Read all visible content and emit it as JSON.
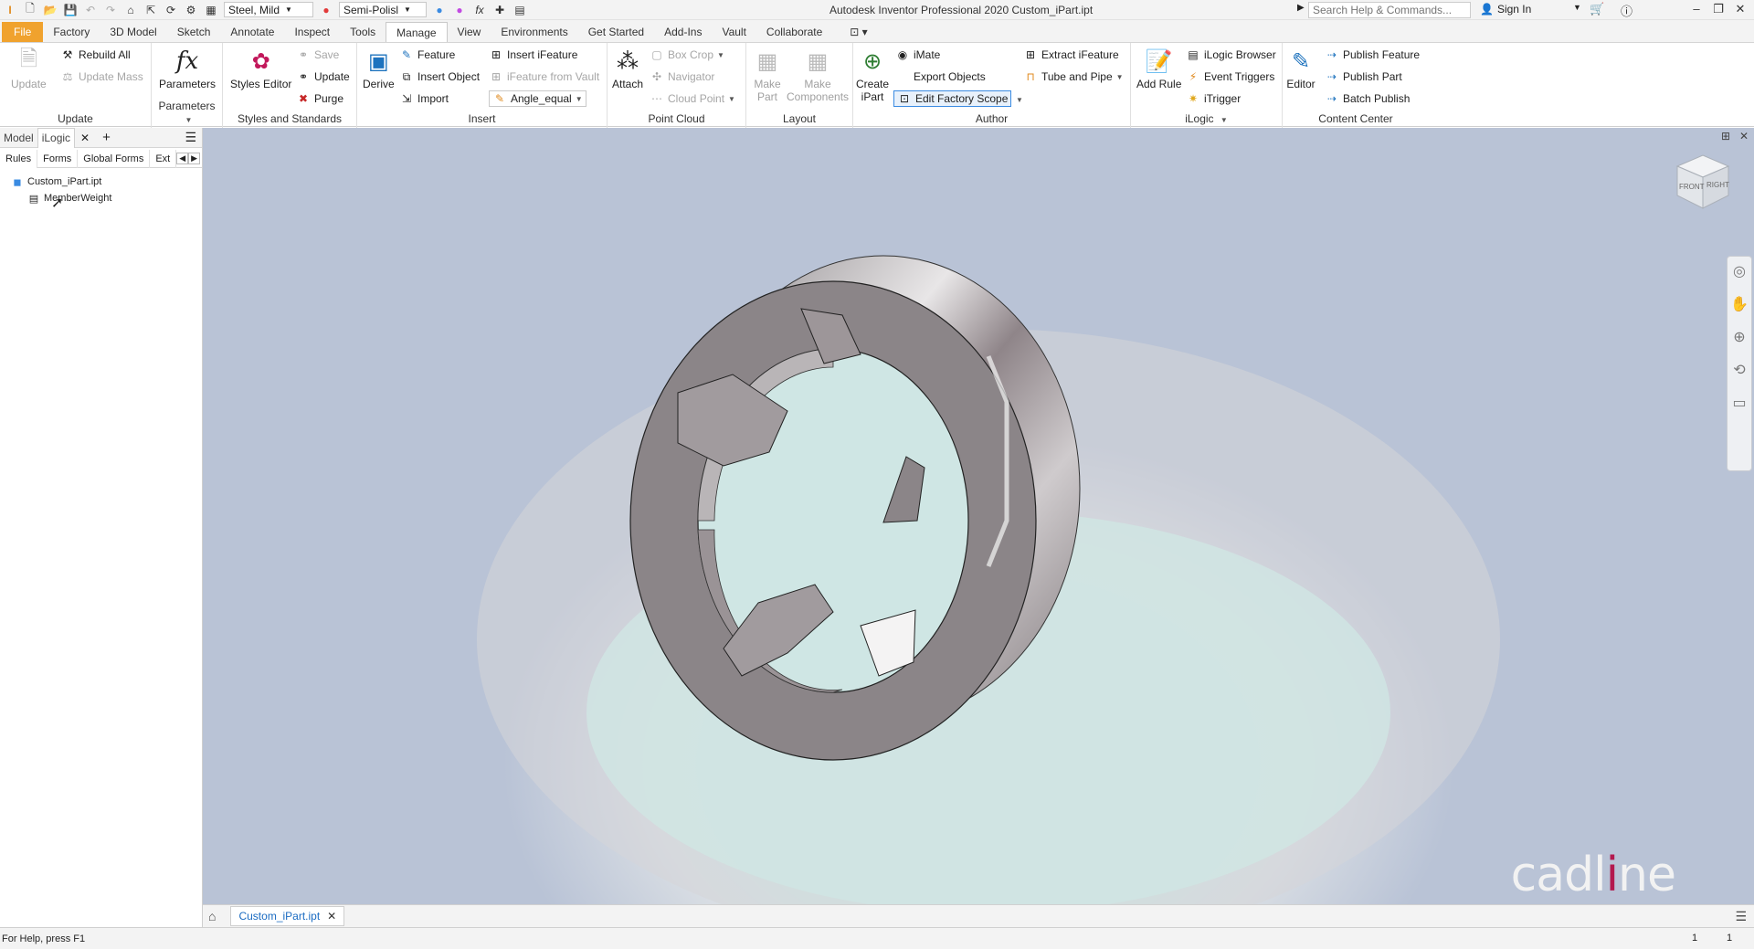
{
  "titlebar": {
    "material": "Steel, Mild",
    "appearance": "Semi-Polisl",
    "app_title": "Autodesk Inventor Professional 2020   Custom_iPart.ipt",
    "search_placeholder": "Search Help & Commands...",
    "sign_in": "Sign In"
  },
  "menu": {
    "tabs": [
      "File",
      "Factory",
      "3D Model",
      "Sketch",
      "Annotate",
      "Inspect",
      "Tools",
      "Manage",
      "View",
      "Environments",
      "Get Started",
      "Add-Ins",
      "Vault",
      "Collaborate"
    ],
    "active": "Manage"
  },
  "ribbon": {
    "update": {
      "update": "Update",
      "rebuild_all": "Rebuild All",
      "update_mass": "Update Mass",
      "title": "Update"
    },
    "parameters": {
      "parameters": "Parameters",
      "title": "Parameters"
    },
    "styles": {
      "styles_editor": "Styles Editor",
      "save": "Save",
      "update": "Update",
      "purge": "Purge",
      "title": "Styles and Standards"
    },
    "insert": {
      "derive": "Derive",
      "feature": "Feature",
      "insert_object": "Insert Object",
      "import": "Import",
      "insert_ifeature": "Insert iFeature",
      "ifeature_vault": "iFeature from Vault",
      "angle_equal": "Angle_equal",
      "title": "Insert"
    },
    "point_cloud": {
      "attach": "Attach",
      "box_crop": "Box Crop",
      "navigator": "Navigator",
      "cloud_point": "Cloud Point",
      "title": "Point Cloud"
    },
    "layout": {
      "make_part": "Make Part",
      "make_components": "Make Components",
      "title": "Layout"
    },
    "author": {
      "create_ipart": "Create iPart",
      "imate": "iMate",
      "export_objects": "Export Objects",
      "edit_factory_scope": "Edit Factory Scope",
      "extract_ifeature": "Extract iFeature",
      "tube_and_pipe": "Tube and Pipe",
      "title": "Author"
    },
    "ilogic": {
      "add_rule": "Add Rule",
      "ilogic_browser": "iLogic Browser",
      "event_triggers": "Event Triggers",
      "itrigger": "iTrigger",
      "title": "iLogic"
    },
    "content_center": {
      "editor": "Editor",
      "publish_feature": "Publish Feature",
      "publish_part": "Publish Part",
      "batch_publish": "Batch Publish",
      "title": "Content Center"
    }
  },
  "browser": {
    "tabs": [
      "Model",
      "iLogic"
    ],
    "subtabs": [
      "Rules",
      "Forms",
      "Global Forms",
      "Ext"
    ],
    "tree": {
      "root": "Custom_iPart.ipt",
      "rule": "MemberWeight"
    }
  },
  "viewcube": {
    "front": "FRONT",
    "right": "RIGHT"
  },
  "logo": {
    "text": "cadline"
  },
  "doctab": {
    "name": "Custom_iPart.ipt"
  },
  "status": {
    "help": "For Help, press F1",
    "count1": "1",
    "count2": "1"
  }
}
